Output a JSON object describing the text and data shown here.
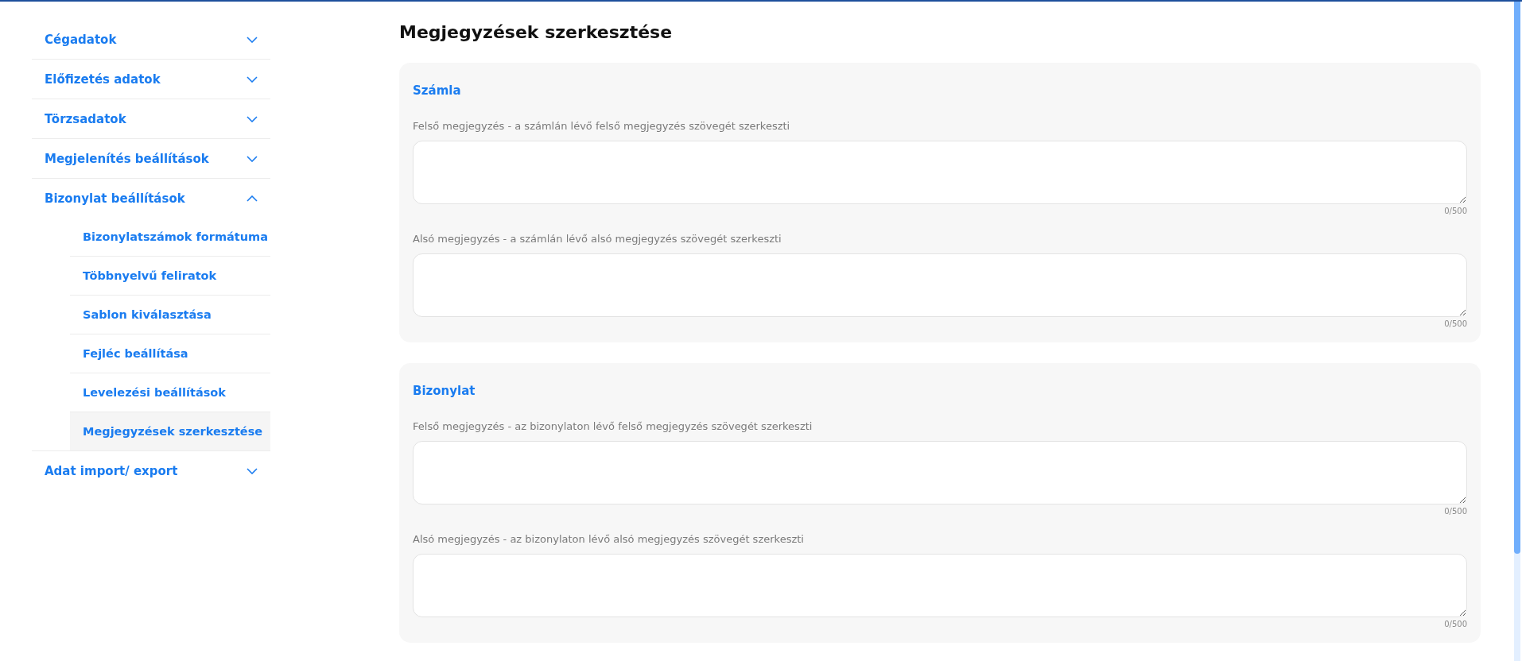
{
  "sidebar": {
    "items": [
      {
        "label": "Cégadatok",
        "expanded": false
      },
      {
        "label": "Előfizetés adatok",
        "expanded": false
      },
      {
        "label": "Törzsadatok",
        "expanded": false
      },
      {
        "label": "Megjelenítés beállítások",
        "expanded": false
      },
      {
        "label": "Bizonylat beállítások",
        "expanded": true,
        "children": [
          {
            "label": "Bizonylatszámok formátuma",
            "selected": false
          },
          {
            "label": "Többnyelvű feliratok",
            "selected": false
          },
          {
            "label": "Sablon kiválasztása",
            "selected": false
          },
          {
            "label": "Fejléc beállítása",
            "selected": false
          },
          {
            "label": "Levelezési beállítások",
            "selected": false
          },
          {
            "label": "Megjegyzések szerkesztése",
            "selected": true
          }
        ]
      },
      {
        "label": "Adat import/ export",
        "expanded": false
      }
    ]
  },
  "page_title": "Megjegyzések szerkesztése",
  "sections": [
    {
      "title": "Számla",
      "fields": [
        {
          "label": "Felső megjegyzés - a számlán lévő felső megjegyzés szövegét szerkeszti",
          "counter": "0/500"
        },
        {
          "label": "Alsó megjegyzés - a számlán lévő alsó megjegyzés szövegét szerkeszti",
          "counter": "0/500"
        }
      ]
    },
    {
      "title": "Bizonylat",
      "fields": [
        {
          "label": "Felső megjegyzés - az bizonylaton lévő felső megjegyzés szövegét szerkeszti",
          "counter": "0/500"
        },
        {
          "label": "Alsó megjegyzés - az bizonylaton lévő alsó megjegyzés szövegét szerkeszti",
          "counter": "0/500"
        }
      ]
    }
  ]
}
